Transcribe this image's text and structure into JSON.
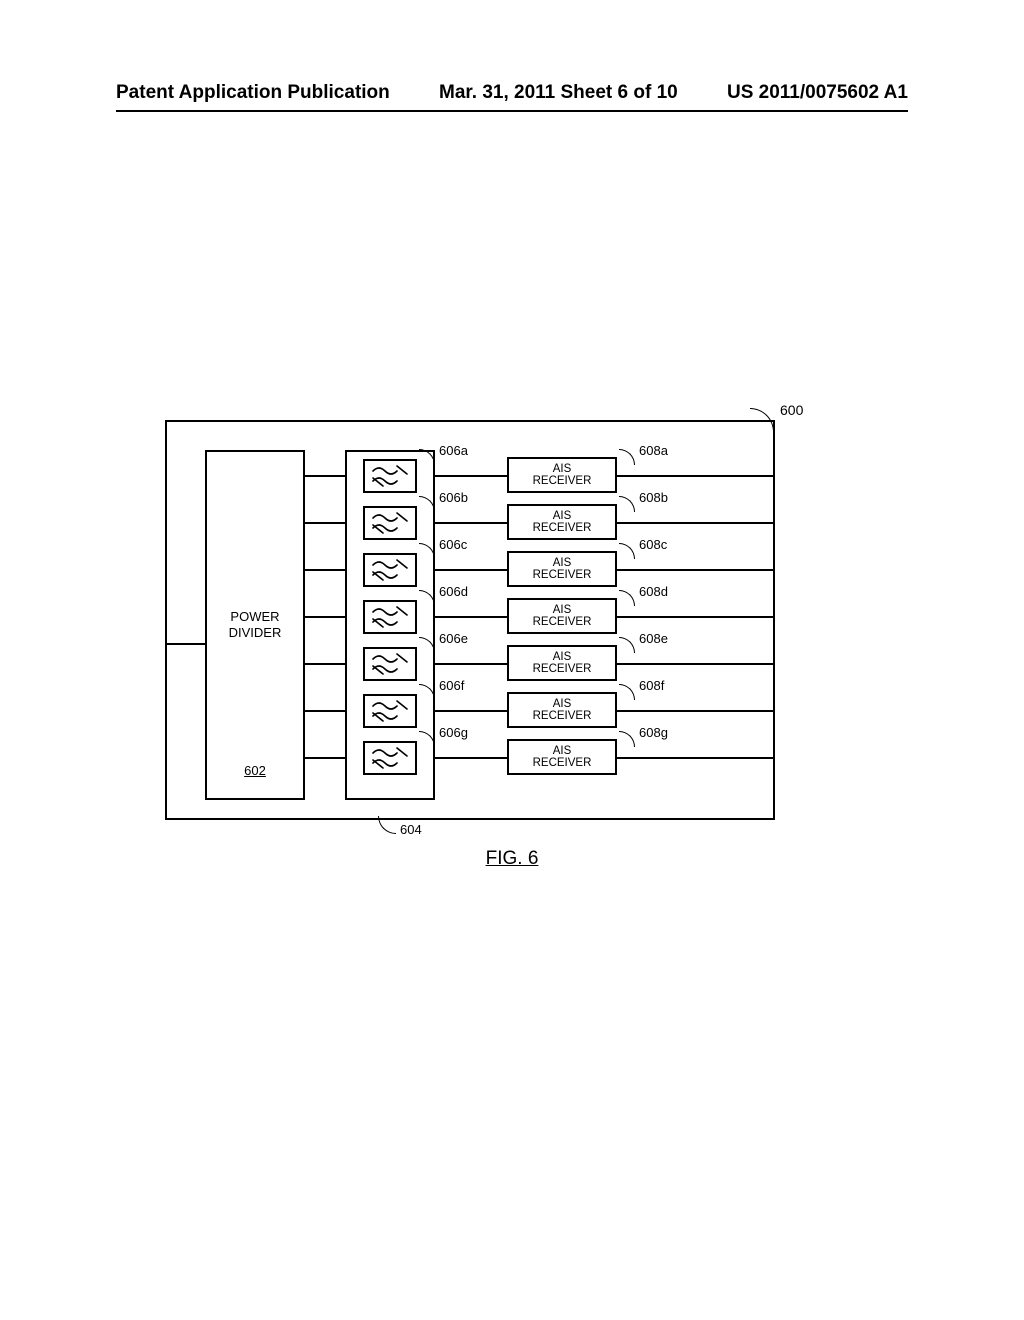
{
  "header": {
    "left": "Patent Application Publication",
    "mid": "Mar. 31, 2011  Sheet 6 of 10",
    "right": "US 2011/0075602 A1"
  },
  "diagram": {
    "system_ref": "600",
    "power_divider": {
      "label1": "POWER",
      "label2": "DIVIDER",
      "ref": "602"
    },
    "filter_group_ref": "604",
    "ais_label1": "AIS",
    "ais_label2": "RECEIVER",
    "rows": [
      {
        "filter_ref": "606a",
        "ais_ref": "608a"
      },
      {
        "filter_ref": "606b",
        "ais_ref": "608b"
      },
      {
        "filter_ref": "606c",
        "ais_ref": "608c"
      },
      {
        "filter_ref": "606d",
        "ais_ref": "608d"
      },
      {
        "filter_ref": "606e",
        "ais_ref": "608e"
      },
      {
        "filter_ref": "606f",
        "ais_ref": "608f"
      },
      {
        "filter_ref": "606g",
        "ais_ref": "608g"
      }
    ]
  },
  "figure_caption": "FIG. 6"
}
